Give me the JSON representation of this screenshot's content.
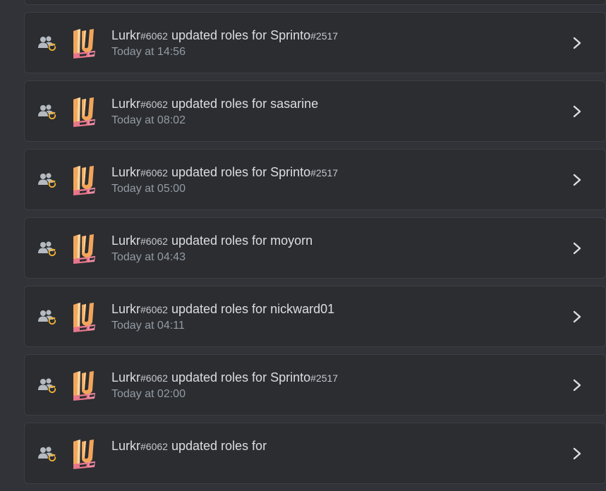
{
  "audit_log": {
    "entries": [
      {
        "actor": "Lurkr",
        "actor_tag": "#6062",
        "action": "updated roles for",
        "target": "",
        "target_tag": "",
        "time": ""
      },
      {
        "actor": "Lurkr",
        "actor_tag": "#6062",
        "action": "updated roles for",
        "target": "Sprinto",
        "target_tag": "#2517",
        "time": "Today at 14:56"
      },
      {
        "actor": "Lurkr",
        "actor_tag": "#6062",
        "action": "updated roles for",
        "target": "sasarine",
        "target_tag": "",
        "time": "Today at 08:02"
      },
      {
        "actor": "Lurkr",
        "actor_tag": "#6062",
        "action": "updated roles for",
        "target": "Sprinto",
        "target_tag": "#2517",
        "time": "Today at 05:00"
      },
      {
        "actor": "Lurkr",
        "actor_tag": "#6062",
        "action": "updated roles for",
        "target": "moyorn",
        "target_tag": "",
        "time": "Today at 04:43"
      },
      {
        "actor": "Lurkr",
        "actor_tag": "#6062",
        "action": "updated roles for",
        "target": "nickward01",
        "target_tag": "",
        "time": "Today at 04:11"
      },
      {
        "actor": "Lurkr",
        "actor_tag": "#6062",
        "action": "updated roles for",
        "target": "Sprinto",
        "target_tag": "#2517",
        "time": "Today at 02:00"
      },
      {
        "actor": "Lurkr",
        "actor_tag": "#6062",
        "action": "updated roles for",
        "target": "",
        "target_tag": "",
        "time": ""
      }
    ]
  },
  "icons": {
    "role": "member-roles-update-icon",
    "chevron": "chevron-right-icon",
    "avatar": "lurkr-avatar"
  },
  "colors": {
    "background": "#313338",
    "card": "#2b2d31",
    "border": "#3c3e44",
    "text_primary": "#dbdee1",
    "text_secondary": "#949ba4",
    "icon_gray": "#b5bac1",
    "accent_orange": "#f0b232"
  }
}
